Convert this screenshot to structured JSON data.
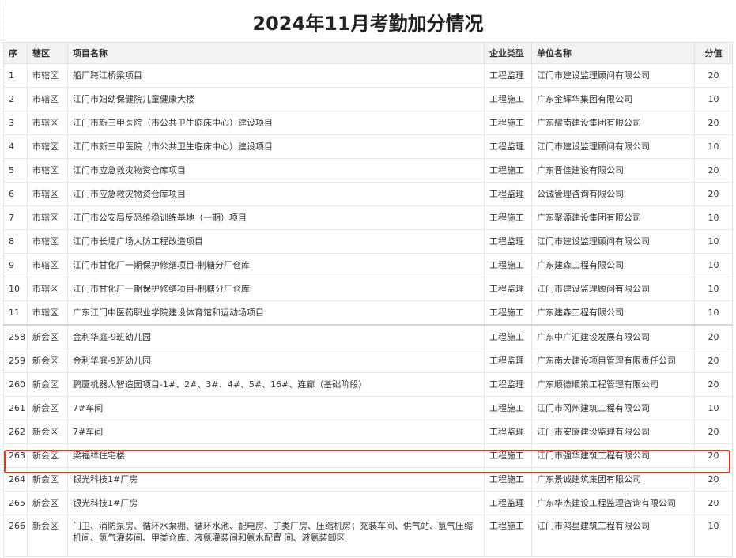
{
  "page_title": "2024年11月考勤加分情况",
  "table": {
    "headers": {
      "no": "序",
      "district": "辖区",
      "project": "项目名称",
      "type": "企业类型",
      "company": "单位名称",
      "score": "分值"
    },
    "rows": [
      {
        "no": "1",
        "district": "市辖区",
        "project": "船厂跨江桥梁项目",
        "type": "工程监理",
        "company": "江门市建设监理顾问有限公司",
        "score": "20"
      },
      {
        "no": "2",
        "district": "市辖区",
        "project": "江门市妇幼保健院儿童健康大楼",
        "type": "工程施工",
        "company": "广东金辉华集团有限公司",
        "score": "10"
      },
      {
        "no": "3",
        "district": "市辖区",
        "project": "江门市新三甲医院（市公共卫生临床中心）建设项目",
        "type": "工程施工",
        "company": "广东耀南建设集团有限公司",
        "score": "20"
      },
      {
        "no": "4",
        "district": "市辖区",
        "project": "江门市新三甲医院（市公共卫生临床中心）建设项目",
        "type": "工程监理",
        "company": "江门市建设监理顾问有限公司",
        "score": "10"
      },
      {
        "no": "5",
        "district": "市辖区",
        "project": "江门市应急救灾物资仓库项目",
        "type": "工程施工",
        "company": "广东晋佳建设有限公司",
        "score": "20"
      },
      {
        "no": "6",
        "district": "市辖区",
        "project": "江门市应急救灾物资仓库项目",
        "type": "工程监理",
        "company": "公诚管理咨询有限公司",
        "score": "20"
      },
      {
        "no": "7",
        "district": "市辖区",
        "project": "江门市公安局反恐维稳训练基地（一期）项目",
        "type": "工程施工",
        "company": "广东聚源建设集团有限公司",
        "score": "10"
      },
      {
        "no": "8",
        "district": "市辖区",
        "project": "江门市长堤广场人防工程改造项目",
        "type": "工程监理",
        "company": "江门市建设监理顾问有限公司",
        "score": "10"
      },
      {
        "no": "9",
        "district": "市辖区",
        "project": "江门市甘化厂一期保护修缮项目-制糖分厂仓库",
        "type": "工程施工",
        "company": "广东建森工程有限公司",
        "score": "10"
      },
      {
        "no": "10",
        "district": "市辖区",
        "project": "江门市甘化厂一期保护修缮项目-制糖分厂仓库",
        "type": "工程监理",
        "company": "江门市建设监理顾问有限公司",
        "score": "10"
      },
      {
        "no": "11",
        "district": "市辖区",
        "project": "广东江门中医药职业学院建设体育馆和运动场项目",
        "type": "工程施工",
        "company": "广东建森工程有限公司",
        "score": "10"
      },
      {
        "no": "258",
        "district": "新会区",
        "project": "金利华庭-9班幼儿园",
        "type": "工程施工",
        "company": "广东中广汇建设发展有限公司",
        "score": "20"
      },
      {
        "no": "259",
        "district": "新会区",
        "project": "金利华庭-9班幼儿园",
        "type": "工程监理",
        "company": "广东南大建设项目管理有限责任公司",
        "score": "20"
      },
      {
        "no": "260",
        "district": "新会区",
        "project": "鹏厦机器人智造园项目-1#、2#、3#、4#、5#、16#、连廊（基础阶段）",
        "type": "工程监理",
        "company": "广东顺德顺策工程管理有限公司",
        "score": "20"
      },
      {
        "no": "261",
        "district": "新会区",
        "project": "7#车间",
        "type": "工程施工",
        "company": "江门市冈州建筑工程有限公司",
        "score": "10"
      },
      {
        "no": "262",
        "district": "新会区",
        "project": "7#车间",
        "type": "工程监理",
        "company": "江门市安厦建设监理有限公司",
        "score": "20"
      },
      {
        "no": "263",
        "district": "新会区",
        "project": "梁福祥住宅楼",
        "type": "工程施工",
        "company": "江门市强华建筑工程有限公司",
        "score": "20"
      },
      {
        "no": "264",
        "district": "新会区",
        "project": "银光科技1#厂房",
        "type": "工程施工",
        "company": "广东景诚建筑集团有限公司",
        "score": "20"
      },
      {
        "no": "265",
        "district": "新会区",
        "project": "银光科技1#厂房",
        "type": "工程监理",
        "company": "广东华杰建设工程监理咨询有限公司",
        "score": "20"
      },
      {
        "no": "266",
        "district": "新会区",
        "project": "门卫、消防泵房、循环水泵棚、循环水池、配电房、丁类厂房、压缩机房；充装车间、供气站、氢气压缩机间、氢气灌装间、甲类仓库、液氨灌装间和氨水配置 间、液氨装卸区",
        "type": "工程施工",
        "company": "江门市鸿星建筑工程有限公司",
        "score": "10"
      }
    ]
  }
}
